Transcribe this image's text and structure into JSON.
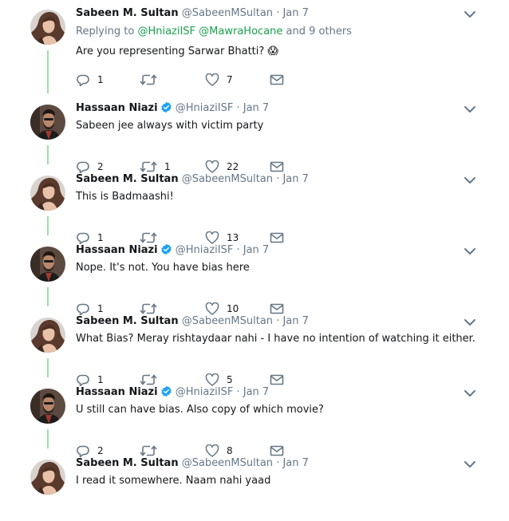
{
  "tweets": [
    {
      "author": "Sabeen M. Sultan",
      "handle": "@SabeenMSultan",
      "sep": "·",
      "time": "Jan 7",
      "verified": false,
      "replying": {
        "prefix": "Replying to",
        "mention1": "@HniaziISF",
        "mention2": "@MawraHocane",
        "suffix": "and 9 others"
      },
      "text": "Are you representing Sarwar Bhatti? 😱",
      "counts": {
        "reply": "1",
        "retweet": "",
        "like": "7"
      },
      "avatar": "woman"
    },
    {
      "author": "Hassaan Niazi",
      "handle": "@HniaziISF",
      "sep": "·",
      "time": "Jan 7",
      "verified": true,
      "text": "Sabeen jee always with victim party",
      "counts": {
        "reply": "2",
        "retweet": "1",
        "like": "22"
      },
      "avatar": "man"
    },
    {
      "author": "Sabeen M. Sultan",
      "handle": "@SabeenMSultan",
      "sep": "·",
      "time": "Jan 7",
      "verified": false,
      "text": "This is Badmaashi!",
      "counts": {
        "reply": "1",
        "retweet": "",
        "like": "13"
      },
      "avatar": "woman"
    },
    {
      "author": "Hassaan Niazi",
      "handle": "@HniaziISF",
      "sep": "·",
      "time": "Jan 7",
      "verified": true,
      "text": "Nope. It's not. You have bias here",
      "counts": {
        "reply": "1",
        "retweet": "",
        "like": "10"
      },
      "avatar": "man"
    },
    {
      "author": "Sabeen M. Sultan",
      "handle": "@SabeenMSultan",
      "sep": "·",
      "time": "Jan 7",
      "verified": false,
      "text": "What Bias? Meray rishtaydaar nahi - I have no intention of watching it either.",
      "counts": {
        "reply": "1",
        "retweet": "",
        "like": "5"
      },
      "avatar": "woman"
    },
    {
      "author": "Hassaan Niazi",
      "handle": "@HniaziISF",
      "sep": "·",
      "time": "Jan 7",
      "verified": true,
      "text": "U still can have bias. Also copy of which movie?",
      "counts": {
        "reply": "2",
        "retweet": "",
        "like": "8"
      },
      "avatar": "man"
    },
    {
      "author": "Sabeen M. Sultan",
      "handle": "@SabeenMSultan",
      "sep": "·",
      "time": "Jan 7",
      "verified": false,
      "text": "I read it somewhere. Naam nahi yaad",
      "counts": {
        "reply": "",
        "retweet": "",
        "like": ""
      },
      "avatar": "woman"
    }
  ],
  "colors": {
    "thread_line": "#98e3a0",
    "mention": "#1ba04e",
    "verified": "#1da1f2",
    "muted": "#657786"
  },
  "icons": {
    "reply": "reply-icon",
    "retweet": "retweet-icon",
    "like": "heart-icon",
    "dm": "envelope-icon",
    "menu": "chevron-down-icon",
    "verified": "verified-badge-icon"
  }
}
